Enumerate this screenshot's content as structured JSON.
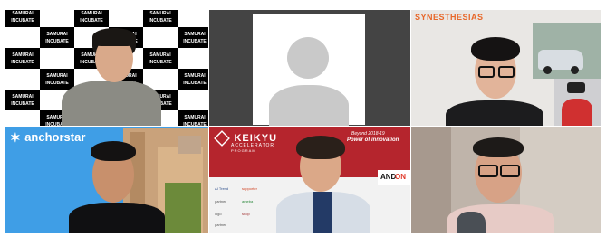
{
  "tiles": [
    {
      "id": "samurai",
      "logo_text": "SAMURAI INCUBATE"
    },
    {
      "id": "placeholder"
    },
    {
      "id": "synesthesias",
      "logo_text": "SYNESTHESIAS"
    },
    {
      "id": "anchorstar",
      "logo_text": "anchorstar"
    },
    {
      "id": "keikyu",
      "brand": "KEIKYU",
      "brand_sub": "ACCELERATOR",
      "brand_sub2": "PROGRAM",
      "tagline1": "Beyond 2018-19",
      "tagline2": "Power of innovation",
      "andon_a": "AND",
      "andon_b": "ON",
      "sponsors": [
        "AI Trend",
        "supporter",
        "partner",
        "ameba",
        "logo",
        "shop",
        "partner"
      ]
    },
    {
      "id": "guest-glasses"
    }
  ],
  "colors": {
    "keikyu_red": "#b5252d",
    "synesthesias_orange": "#e8682a",
    "anchorstar_blue": "#1e8ee0",
    "placeholder_bg": "#444444",
    "placeholder_avatar": "#c9c9c9"
  }
}
